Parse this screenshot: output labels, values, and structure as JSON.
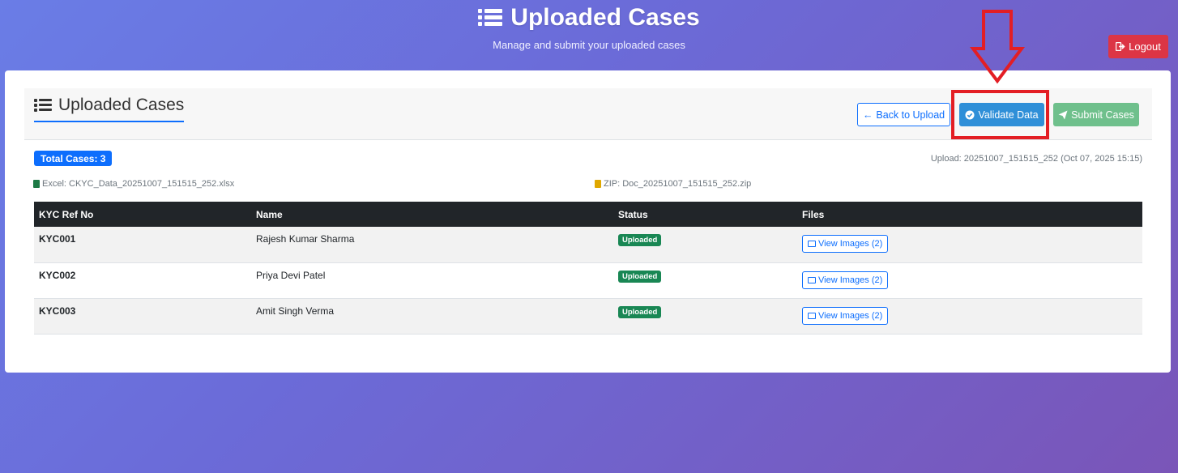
{
  "hero": {
    "title": "Uploaded Cases",
    "subtitle": "Manage and submit your uploaded cases",
    "icon": "list-icon"
  },
  "logout": {
    "label": "Logout",
    "icon": "sign-out-icon",
    "color": "#dc3545"
  },
  "card": {
    "title": "Uploaded Cases",
    "buttons": {
      "back": "Back to Upload",
      "validate": "Validate Data",
      "submit": "Submit Cases"
    },
    "total_badge": "Total Cases: 3",
    "upload_info": "Upload: 20251007_151515_252 (Oct 07, 2025 15:15)",
    "excel_file": "Excel: CKYC_Data_20251007_151515_252.xlsx",
    "zip_file": "ZIP: Doc_20251007_151515_252.zip"
  },
  "table": {
    "headers": [
      "KYC Ref No",
      "Name",
      "Status",
      "Files"
    ],
    "rows": [
      {
        "ref": "KYC001",
        "name": "Rajesh Kumar Sharma",
        "status": "Uploaded",
        "files": "View Images (2)"
      },
      {
        "ref": "KYC002",
        "name": "Priya Devi Patel",
        "status": "Uploaded",
        "files": "View Images (2)"
      },
      {
        "ref": "KYC003",
        "name": "Amit Singh Verma",
        "status": "Uploaded",
        "files": "View Images (2)"
      }
    ]
  },
  "colors": {
    "primary": "#0d6efd",
    "validate": "#2f8fd8",
    "submit": "#6fc08c",
    "success": "#198754",
    "annotation": "#e31e24"
  }
}
